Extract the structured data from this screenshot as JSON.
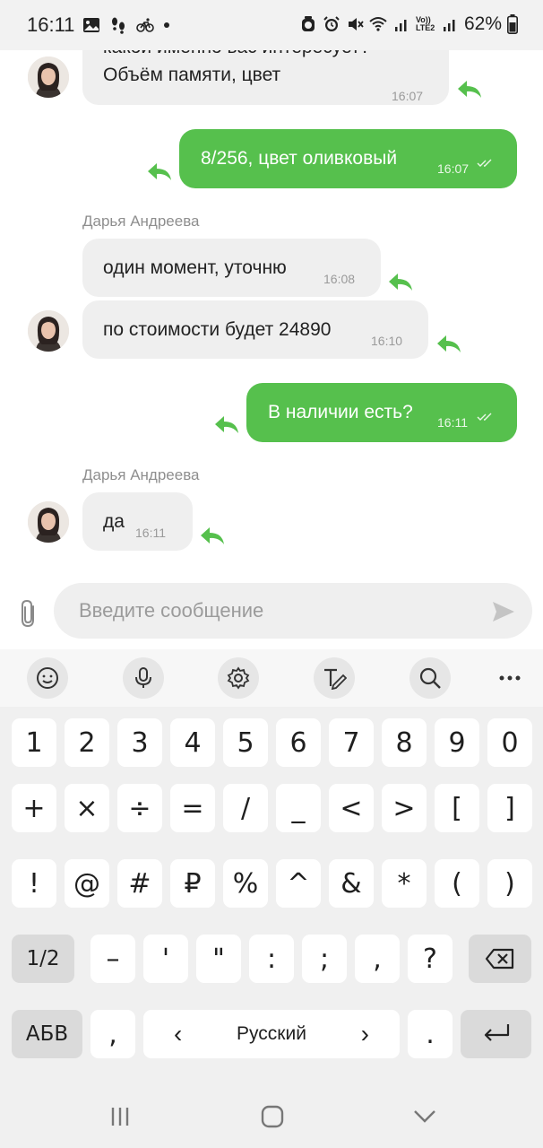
{
  "status_bar": {
    "time": "16:11",
    "battery": "62%",
    "left_icons": [
      "image-icon",
      "steps-icon",
      "bike-icon",
      "dot-icon"
    ],
    "right_icons": [
      "alarm-shield-icon",
      "alarm-icon",
      "mute-icon",
      "wifi-icon",
      "signal-icon",
      "volte-icon",
      "signal-icon",
      "battery-icon"
    ],
    "volte_label": "Vo)) LTE2"
  },
  "chat": {
    "sender_name": "Дарья Андреева",
    "messages": [
      {
        "side": "in",
        "lines": [
          "какой именно вас интересует?",
          "Объём памяти, цвет"
        ],
        "time": "16:07"
      },
      {
        "side": "out",
        "text": "8/256, цвет оливковый",
        "time": "16:07",
        "status": "read"
      },
      {
        "side": "in",
        "sender": "Дарья Андреева",
        "text": "один момент, уточню",
        "time": "16:08"
      },
      {
        "side": "in",
        "text": "по стоимости будет 24890",
        "time": "16:10"
      },
      {
        "side": "out",
        "text": "В наличии есть?",
        "time": "16:11",
        "status": "read"
      },
      {
        "side": "in",
        "sender": "Дарья Андреева",
        "text": "да",
        "time": "16:11"
      }
    ]
  },
  "composer": {
    "placeholder": "Введите сообщение"
  },
  "keyboard": {
    "toolbar": [
      "emoji-icon",
      "microphone-icon",
      "settings-icon",
      "handwriting-icon",
      "search-icon",
      "more-icon"
    ],
    "row1": [
      "1",
      "2",
      "3",
      "4",
      "5",
      "6",
      "7",
      "8",
      "9",
      "0"
    ],
    "row2": [
      "+",
      "×",
      "÷",
      "=",
      "/",
      "_",
      "<",
      ">",
      "[",
      "]"
    ],
    "row3": [
      "!",
      "@",
      "#",
      "₽",
      "%",
      "^",
      "&",
      "*",
      "(",
      ")"
    ],
    "row4": {
      "shift": "1/2",
      "keys": [
        "–",
        "'",
        "\"",
        ":",
        ";",
        ",",
        "?"
      ]
    },
    "row5": {
      "lang": "АБВ",
      "comma": ",",
      "space": "Русский",
      "left_arrow": "‹",
      "right_arrow": "›",
      "period": "."
    }
  },
  "navbar": [
    "recent-apps-icon",
    "home-icon",
    "back-icon"
  ],
  "colors": {
    "accent": "#56c04d",
    "incoming_bubble": "#efefef",
    "keyboard_bg": "#f0f0f0"
  }
}
